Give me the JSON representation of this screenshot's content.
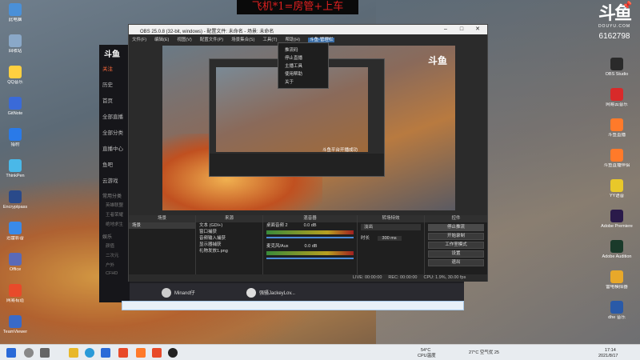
{
  "banner": {
    "text": "飞机*1=房管+上车"
  },
  "douyu_logo": {
    "logo": "斗鱼",
    "url": "DOUYU.COM",
    "room_id": "6162798"
  },
  "desktop_left": [
    {
      "label": "此电脑",
      "icon": "computer-icon",
      "color": "#4a90d8"
    },
    {
      "label": "回收站",
      "icon": "recycle-bin-icon",
      "color": "#8aa8c8"
    },
    {
      "label": "QQ音乐",
      "icon": "qq-music-icon",
      "color": "#ffd040"
    },
    {
      "label": "GitNote",
      "icon": "note-icon",
      "color": "#3a6ad8"
    },
    {
      "label": "猎豹",
      "icon": "app-icon",
      "color": "#2a7ae8"
    },
    {
      "label": "ThinkPen",
      "icon": "pen-icon",
      "color": "#4ab8e8"
    },
    {
      "label": "Encryptpass",
      "icon": "lock-icon",
      "color": "#2a4a8a"
    },
    {
      "label": "迅雷影音",
      "icon": "video-icon",
      "color": "#3a8ae8"
    },
    {
      "label": "Office",
      "icon": "office-icon",
      "color": "#5a6ab8"
    },
    {
      "label": "网易有道",
      "icon": "dict-icon",
      "color": "#e84a2a"
    },
    {
      "label": "TeamViewer",
      "icon": "remote-icon",
      "color": "#3a6ac8"
    }
  ],
  "desktop_right": [
    {
      "label": "OBS Studio",
      "icon": "obs-icon",
      "color": "#2a2a2a"
    },
    {
      "label": "网易云音乐",
      "icon": "music-icon",
      "color": "#d82a2a"
    },
    {
      "label": "斗鱼直播",
      "icon": "douyu-icon",
      "color": "#ff7a2a"
    },
    {
      "label": "斗鱼直播伴侣",
      "icon": "douyu-companion-icon",
      "color": "#ff7a2a"
    },
    {
      "label": "YY语音",
      "icon": "yy-icon",
      "color": "#e8c82a"
    },
    {
      "label": "Adobe Premiere",
      "icon": "premiere-icon",
      "color": "#2a1a4a"
    },
    {
      "label": "Adobe Audition",
      "icon": "audition-icon",
      "color": "#1a3a2a"
    },
    {
      "label": "雷电模拟器",
      "icon": "emulator-icon",
      "color": "#e8a82a"
    },
    {
      "label": "dhe 音乐",
      "icon": "player-icon",
      "color": "#2a5aa8"
    }
  ],
  "client": {
    "logo": "斗鱼",
    "nav": [
      {
        "label": "关注",
        "active": true
      },
      {
        "label": "历史",
        "active": false
      },
      {
        "label": "首页",
        "active": false
      },
      {
        "label": "全部直播",
        "active": false
      },
      {
        "label": "全部分类",
        "active": false
      },
      {
        "label": "直播中心",
        "active": false
      },
      {
        "label": "鱼吧",
        "active": false
      },
      {
        "label": "云游戏",
        "active": false
      }
    ],
    "section1": "常用分类",
    "sub1": [
      "英雄联盟",
      "王者荣耀",
      "绝地求生"
    ],
    "section2": "娱乐",
    "sub2": [
      "颜值",
      "二次元",
      "户外",
      "CFHD"
    ],
    "bottom_user1": "Minand仔",
    "bottom_user2": "强骚JackeyLov..."
  },
  "obs": {
    "title": "OBS 25.0.8 (32-bit, windows) - 配置文件: 未命名 - 场景: 未命名",
    "menu": [
      "文件(F)",
      "编辑(E)",
      "视图(V)",
      "配置文件(P)",
      "场景集合(S)",
      "工具(T)",
      "帮助(H)",
      "斗鱼-管理栏"
    ],
    "open_menu_index": 7,
    "dropdown": [
      "推流码",
      "停止直播",
      "主播工具",
      "使用帮助",
      "关于"
    ],
    "preview_label": "斗鱼平台开播成功",
    "docks": {
      "scenes": {
        "title": "场景",
        "items": [
          "场景"
        ]
      },
      "sources": {
        "title": "来源",
        "items": [
          "文本 (GDI+)",
          "窗口捕获",
          "音频输入捕获",
          "显示器捕获",
          "礼物发放1.png"
        ]
      },
      "mixer": {
        "title": "混音器",
        "tracks": [
          {
            "name": "桌面音频 2",
            "level": "0.0 dB"
          },
          {
            "name": "麦克风/Aux",
            "level": "0.0 dB"
          }
        ]
      },
      "transitions": {
        "title": "转场特效",
        "type": "淡出",
        "duration_label": "时长",
        "duration": "300 ms"
      },
      "controls": {
        "title": "控件",
        "buttons": [
          "停止推流",
          "开始录制",
          "工作室模式",
          "设置",
          "退出"
        ]
      }
    },
    "status": [
      "LIVE: 00:00:00",
      "REC: 00:00:00",
      "CPU: 1.9%, 30.00 fps"
    ]
  },
  "taskbar": {
    "weather": "54°C",
    "weather_sub": "CPU温度",
    "temp": "27°C 空气优 25",
    "time": "17:14",
    "date": "2021/8/17"
  }
}
